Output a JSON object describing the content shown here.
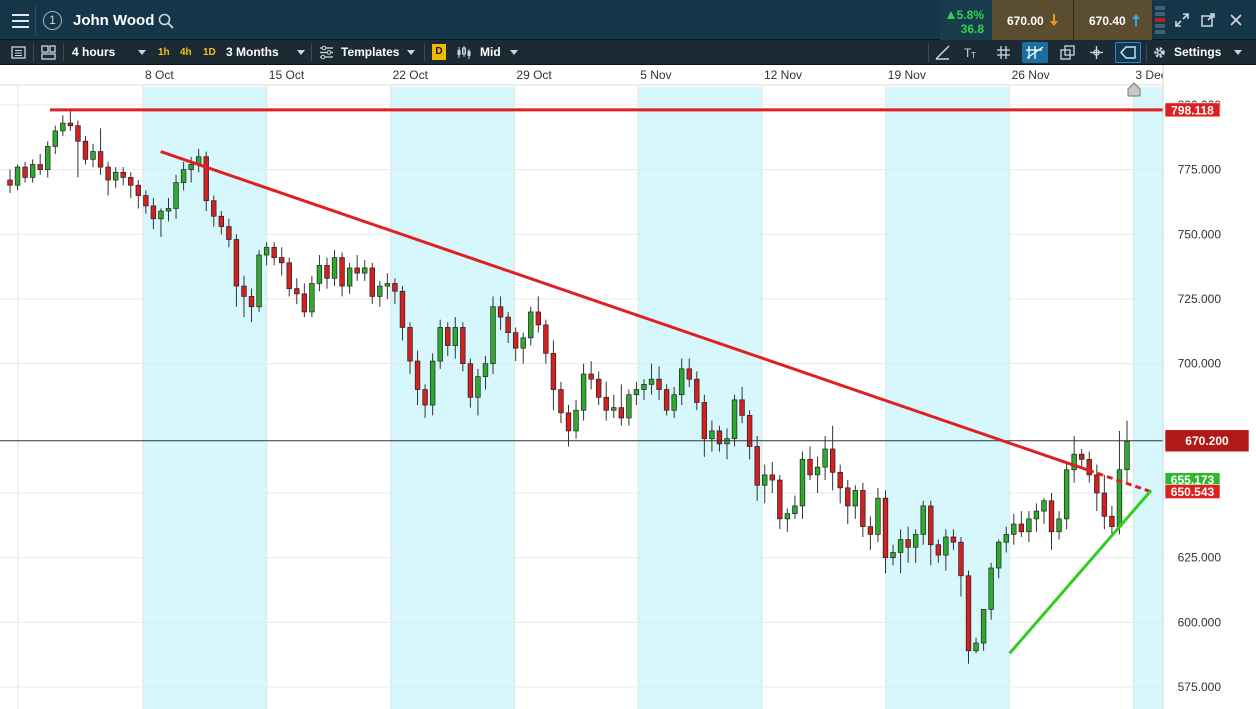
{
  "header": {
    "title": "John Wood",
    "change_pct": "5.8%",
    "change_abs": "36.8",
    "sell_price": "670.00",
    "buy_price": "670.40",
    "colors": {
      "up": "#33d04f",
      "sell_bg": "#5b4d2f",
      "header_bg": "#143648"
    }
  },
  "toolbar": {
    "interval": "4 hours",
    "quick_intervals": [
      "1h",
      "4h",
      "1D"
    ],
    "range": "3 Months",
    "templates_label": "Templates",
    "d_label": "D",
    "price_type": "Mid",
    "settings_label": "Settings"
  },
  "chart_data": {
    "type": "candlestick",
    "x_tick_labels": [
      "8 Oct",
      "15 Oct",
      "22 Oct",
      "29 Oct",
      "5 Nov",
      "12 Nov",
      "19 Nov",
      "26 Nov",
      "3 Dec"
    ],
    "y_tick_labels": [
      "800.000",
      "775.000",
      "750.000",
      "725.000",
      "700.000",
      "625.000",
      "600.000",
      "575.000"
    ],
    "y_ticks": [
      800,
      775,
      750,
      725,
      700,
      650,
      625,
      600,
      575
    ],
    "ylim": [
      572,
      808
    ],
    "grid": true,
    "current_price": {
      "label": "670.200",
      "value": 670.2
    },
    "horizontal_level": {
      "label": "798.118",
      "value": 798.118
    },
    "trendlines": [
      {
        "name": "resistance",
        "color": "#e02020",
        "from": {
          "x": "2018-10-09",
          "y": 782
        },
        "to": {
          "x": "2018-12-04",
          "y": 650.5
        }
      },
      {
        "name": "support",
        "color": "#33cc22",
        "from": {
          "x": "2018-11-26",
          "y": 588
        },
        "to": {
          "x": "2018-12-04",
          "y": 651
        }
      }
    ],
    "level_labels": [
      {
        "label": "655.173",
        "value": 655.173,
        "color": "#2fb82f"
      },
      {
        "label": "650.543",
        "value": 650.543,
        "color": "#e02020"
      }
    ],
    "candles": [
      [
        771,
        775,
        766,
        769
      ],
      [
        769,
        777,
        767,
        776
      ],
      [
        776,
        778,
        770,
        772
      ],
      [
        772,
        779,
        770,
        777
      ],
      [
        777,
        781,
        773,
        775
      ],
      [
        775,
        786,
        772,
        784
      ],
      [
        784,
        792,
        781,
        790
      ],
      [
        790,
        796,
        788,
        793
      ],
      [
        793,
        798,
        790,
        792
      ],
      [
        792,
        794,
        772,
        786
      ],
      [
        786,
        788,
        777,
        779
      ],
      [
        779,
        785,
        776,
        782
      ],
      [
        782,
        791,
        773,
        776
      ],
      [
        776,
        778,
        765,
        771
      ],
      [
        771,
        776,
        768,
        774
      ],
      [
        774,
        776,
        769,
        772
      ],
      [
        772,
        774,
        764,
        769
      ],
      [
        769,
        771,
        760,
        765
      ],
      [
        765,
        767,
        758,
        761
      ],
      [
        761,
        764,
        752,
        756
      ],
      [
        756,
        760,
        749,
        759
      ],
      [
        759,
        764,
        755,
        760
      ],
      [
        760,
        773,
        756,
        770
      ],
      [
        770,
        778,
        767,
        775
      ],
      [
        775,
        780,
        770,
        777
      ],
      [
        777,
        783,
        774,
        780
      ],
      [
        780,
        782,
        759,
        763
      ],
      [
        763,
        765,
        753,
        757
      ],
      [
        757,
        759,
        750,
        753
      ],
      [
        753,
        756,
        745,
        748
      ],
      [
        748,
        750,
        722,
        730
      ],
      [
        730,
        734,
        718,
        726
      ],
      [
        726,
        729,
        716,
        722
      ],
      [
        722,
        744,
        720,
        742
      ],
      [
        742,
        747,
        738,
        745
      ],
      [
        745,
        747,
        738,
        741
      ],
      [
        741,
        745,
        734,
        739
      ],
      [
        739,
        741,
        726,
        729
      ],
      [
        729,
        733,
        723,
        727
      ],
      [
        727,
        731,
        718,
        720
      ],
      [
        720,
        734,
        718,
        731
      ],
      [
        731,
        742,
        728,
        738
      ],
      [
        738,
        741,
        729,
        733
      ],
      [
        733,
        744,
        730,
        741
      ],
      [
        741,
        743,
        726,
        730
      ],
      [
        730,
        739,
        727,
        737
      ],
      [
        737,
        742,
        732,
        735
      ],
      [
        735,
        740,
        732,
        737
      ],
      [
        737,
        739,
        723,
        726
      ],
      [
        726,
        732,
        722,
        730
      ],
      [
        730,
        735,
        725,
        731
      ],
      [
        731,
        733,
        723,
        728
      ],
      [
        728,
        730,
        709,
        714
      ],
      [
        714,
        716,
        696,
        701
      ],
      [
        701,
        705,
        684,
        690
      ],
      [
        690,
        692,
        679,
        684
      ],
      [
        684,
        704,
        680,
        701
      ],
      [
        701,
        717,
        698,
        714
      ],
      [
        714,
        716,
        703,
        707
      ],
      [
        707,
        718,
        702,
        714
      ],
      [
        714,
        716,
        697,
        700
      ],
      [
        700,
        702,
        683,
        687
      ],
      [
        687,
        698,
        680,
        695
      ],
      [
        695,
        703,
        690,
        700
      ],
      [
        700,
        726,
        696,
        722
      ],
      [
        722,
        726,
        713,
        718
      ],
      [
        718,
        720,
        708,
        712
      ],
      [
        712,
        714,
        701,
        706
      ],
      [
        706,
        712,
        700,
        710
      ],
      [
        710,
        722,
        707,
        720
      ],
      [
        720,
        726,
        712,
        715
      ],
      [
        715,
        717,
        700,
        704
      ],
      [
        704,
        709,
        682,
        690
      ],
      [
        690,
        693,
        677,
        681
      ],
      [
        681,
        684,
        668,
        674
      ],
      [
        674,
        686,
        671,
        682
      ],
      [
        682,
        700,
        678,
        696
      ],
      [
        696,
        701,
        690,
        694
      ],
      [
        694,
        697,
        684,
        687
      ],
      [
        687,
        693,
        678,
        682
      ],
      [
        682,
        688,
        679,
        683
      ],
      [
        683,
        692,
        676,
        679
      ],
      [
        679,
        690,
        676,
        688
      ],
      [
        688,
        693,
        684,
        690
      ],
      [
        690,
        694,
        686,
        692
      ],
      [
        692,
        700,
        688,
        694
      ],
      [
        694,
        699,
        686,
        690
      ],
      [
        690,
        692,
        680,
        682
      ],
      [
        682,
        691,
        679,
        688
      ],
      [
        688,
        702,
        684,
        698
      ],
      [
        698,
        702,
        691,
        694
      ],
      [
        694,
        697,
        682,
        685
      ],
      [
        685,
        688,
        664,
        671
      ],
      [
        671,
        678,
        666,
        674
      ],
      [
        674,
        676,
        666,
        669
      ],
      [
        669,
        675,
        663,
        671
      ],
      [
        671,
        688,
        668,
        686
      ],
      [
        686,
        691,
        677,
        680
      ],
      [
        680,
        682,
        663,
        668
      ],
      [
        668,
        672,
        647,
        653
      ],
      [
        653,
        661,
        646,
        657
      ],
      [
        657,
        662,
        650,
        655
      ],
      [
        655,
        657,
        636,
        640
      ],
      [
        640,
        644,
        635,
        642
      ],
      [
        642,
        649,
        640,
        645
      ],
      [
        645,
        666,
        640,
        663
      ],
      [
        663,
        668,
        655,
        657
      ],
      [
        657,
        664,
        650,
        660
      ],
      [
        660,
        672,
        655,
        667
      ],
      [
        667,
        676,
        651,
        658
      ],
      [
        658,
        661,
        646,
        652
      ],
      [
        652,
        655,
        638,
        645
      ],
      [
        645,
        653,
        640,
        651
      ],
      [
        651,
        654,
        633,
        637
      ],
      [
        637,
        641,
        628,
        634
      ],
      [
        634,
        652,
        631,
        648
      ],
      [
        648,
        651,
        619,
        625
      ],
      [
        625,
        630,
        622,
        627
      ],
      [
        627,
        636,
        619,
        632
      ],
      [
        632,
        637,
        623,
        629
      ],
      [
        629,
        636,
        623,
        634
      ],
      [
        634,
        647,
        630,
        645
      ],
      [
        645,
        647,
        622,
        630
      ],
      [
        630,
        632,
        623,
        626
      ],
      [
        626,
        636,
        620,
        633
      ],
      [
        633,
        636,
        628,
        631
      ],
      [
        631,
        633,
        610,
        618
      ],
      [
        618,
        620,
        584,
        589
      ],
      [
        589,
        594,
        588,
        592
      ],
      [
        592,
        604,
        589,
        605
      ],
      [
        605,
        623,
        601,
        621
      ],
      [
        621,
        632,
        617,
        631
      ],
      [
        631,
        637,
        627,
        634
      ],
      [
        634,
        642,
        630,
        638
      ],
      [
        638,
        643,
        633,
        635
      ],
      [
        635,
        643,
        631,
        640
      ],
      [
        640,
        646,
        635,
        643
      ],
      [
        643,
        648,
        638,
        647
      ],
      [
        647,
        650,
        628,
        635
      ],
      [
        635,
        643,
        632,
        640
      ],
      [
        640,
        662,
        636,
        659
      ],
      [
        659,
        672,
        654,
        665
      ],
      [
        665,
        667,
        660,
        663
      ],
      [
        663,
        666,
        654,
        657
      ],
      [
        657,
        661,
        643,
        650
      ],
      [
        650,
        657,
        636,
        641
      ],
      [
        641,
        645,
        634,
        637
      ],
      [
        637,
        674,
        634,
        659
      ],
      [
        659,
        678,
        654,
        670
      ]
    ]
  }
}
